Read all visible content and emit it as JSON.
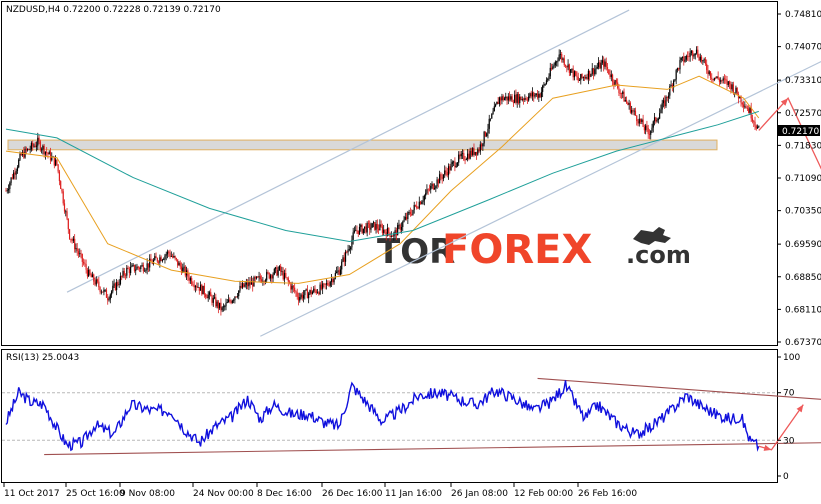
{
  "main_panel": {
    "header": "NZDUSD,H4  0.72200 0.72228 0.72139 0.72170",
    "last_price_label": "0.72170",
    "price_ticks": [
      "0.74810",
      "0.74070",
      "0.73310",
      "0.72570",
      "0.71830",
      "0.71090",
      "0.70350",
      "0.69590",
      "0.68850",
      "0.68110",
      "0.67370"
    ]
  },
  "rsi_panel": {
    "header": "RSI(13) 25.0043",
    "levels": [
      "100",
      "70",
      "30",
      "0"
    ]
  },
  "time_ticks": [
    "11 Oct 2017",
    "25 Oct 16:00",
    "9 Nov 08:00",
    "24 Nov 00:00",
    "8 Dec 16:00",
    "26 Dec 16:00",
    "11 Jan 16:00",
    "26 Jan 08:00",
    "12 Feb 00:00",
    "26 Feb 16:00"
  ],
  "watermark": {
    "part1": "TOR",
    "part2": "FOREX",
    "part3": ".com"
  },
  "colors": {
    "bull": "#000000",
    "bear": "#dd1f1f",
    "ma_fast": "#e8a020",
    "ma_slow": "#20a09a",
    "channel": "#b4c4d8",
    "support_zone": "#d9d9d9",
    "forecast": "#ee5a5a",
    "rsi": "#1010dd",
    "rsi_trend": "#a05050",
    "watermark_tor": "#333333",
    "watermark_forex": "#f0452a"
  },
  "chart_data": [
    {
      "type": "candlestick",
      "symbol": "NZDUSD",
      "timeframe": "H4",
      "ylim": [
        0.6737,
        0.7481
      ],
      "x_tick_labels": [
        "11 Oct 2017",
        "25 Oct 16:00",
        "9 Nov 08:00",
        "24 Nov 00:00",
        "8 Dec 16:00",
        "26 Dec 16:00",
        "11 Jan 16:00",
        "26 Jan 08:00",
        "12 Feb 00:00",
        "26 Feb 16:00"
      ],
      "close_path_anchors": [
        [
          0,
          0.708
        ],
        [
          12,
          0.716
        ],
        [
          25,
          0.719
        ],
        [
          40,
          0.714
        ],
        [
          50,
          0.698
        ],
        [
          65,
          0.689
        ],
        [
          80,
          0.684
        ],
        [
          95,
          0.69
        ],
        [
          110,
          0.691
        ],
        [
          128,
          0.694
        ],
        [
          145,
          0.688
        ],
        [
          160,
          0.684
        ],
        [
          170,
          0.681
        ],
        [
          185,
          0.686
        ],
        [
          200,
          0.688
        ],
        [
          215,
          0.69
        ],
        [
          230,
          0.684
        ],
        [
          250,
          0.686
        ],
        [
          262,
          0.69
        ],
        [
          275,
          0.699
        ],
        [
          290,
          0.7
        ],
        [
          305,
          0.698
        ],
        [
          318,
          0.703
        ],
        [
          335,
          0.709
        ],
        [
          355,
          0.715
        ],
        [
          372,
          0.7175
        ],
        [
          388,
          0.729
        ],
        [
          405,
          0.729
        ],
        [
          420,
          0.73
        ],
        [
          435,
          0.739
        ],
        [
          450,
          0.733
        ],
        [
          470,
          0.737
        ],
        [
          488,
          0.728
        ],
        [
          505,
          0.721
        ],
        [
          518,
          0.728
        ],
        [
          530,
          0.737
        ],
        [
          542,
          0.74
        ],
        [
          555,
          0.734
        ],
        [
          570,
          0.732
        ],
        [
          585,
          0.726
        ],
        [
          592,
          0.7217
        ]
      ],
      "moving_averages": [
        {
          "points": [
            [
              0,
              0.717
            ],
            [
              40,
              0.7155
            ],
            [
              80,
              0.696
            ],
            [
              130,
              0.69
            ],
            [
              180,
              0.6875
            ],
            [
              230,
              0.687
            ],
            [
              270,
              0.689
            ],
            [
              310,
              0.696
            ],
            [
              350,
              0.708
            ],
            [
              390,
              0.718
            ],
            [
              430,
              0.729
            ],
            [
              480,
              0.732
            ],
            [
              520,
              0.731
            ],
            [
              545,
              0.734
            ],
            [
              580,
              0.729
            ],
            [
              592,
              0.7245
            ]
          ]
        },
        {
          "points": [
            [
              0,
              0.722
            ],
            [
              40,
              0.72
            ],
            [
              100,
              0.711
            ],
            [
              160,
              0.704
            ],
            [
              220,
              0.699
            ],
            [
              270,
              0.6965
            ],
            [
              320,
              0.699
            ],
            [
              380,
              0.706
            ],
            [
              430,
              0.712
            ],
            [
              480,
              0.717
            ],
            [
              520,
              0.72
            ],
            [
              560,
              0.723
            ],
            [
              592,
              0.726
            ]
          ]
        }
      ],
      "support_zone": [
        0.7173,
        0.7195
      ],
      "channel_lines": [
        [
          [
            48,
            0.685
          ],
          [
            490,
            0.749
          ]
        ],
        [
          [
            200,
            0.675
          ],
          [
            660,
            0.74
          ]
        ]
      ],
      "forecast_path": [
        [
          592,
          0.7217
        ],
        [
          615,
          0.729
        ],
        [
          655,
          0.7045
        ]
      ]
    },
    {
      "type": "line",
      "name": "RSI(13)",
      "last_value": 25.0043,
      "ylim": [
        0,
        100
      ],
      "levels": [
        70,
        30
      ],
      "path_anchors": [
        [
          0,
          45
        ],
        [
          10,
          70
        ],
        [
          20,
          62
        ],
        [
          30,
          60
        ],
        [
          40,
          40
        ],
        [
          48,
          26
        ],
        [
          60,
          28
        ],
        [
          70,
          43
        ],
        [
          85,
          35
        ],
        [
          98,
          60
        ],
        [
          115,
          55
        ],
        [
          130,
          55
        ],
        [
          140,
          40
        ],
        [
          152,
          28
        ],
        [
          165,
          42
        ],
        [
          178,
          50
        ],
        [
          190,
          65
        ],
        [
          200,
          48
        ],
        [
          210,
          60
        ],
        [
          225,
          52
        ],
        [
          238,
          52
        ],
        [
          250,
          45
        ],
        [
          262,
          42
        ],
        [
          272,
          76
        ],
        [
          285,
          60
        ],
        [
          296,
          46
        ],
        [
          310,
          55
        ],
        [
          325,
          68
        ],
        [
          340,
          70
        ],
        [
          355,
          65
        ],
        [
          370,
          60
        ],
        [
          385,
          72
        ],
        [
          400,
          65
        ],
        [
          415,
          55
        ],
        [
          428,
          62
        ],
        [
          440,
          76
        ],
        [
          455,
          48
        ],
        [
          465,
          60
        ],
        [
          480,
          45
        ],
        [
          495,
          35
        ],
        [
          505,
          40
        ],
        [
          520,
          52
        ],
        [
          535,
          68
        ],
        [
          545,
          60
        ],
        [
          558,
          52
        ],
        [
          570,
          48
        ],
        [
          578,
          50
        ],
        [
          585,
          30
        ],
        [
          592,
          25
        ]
      ],
      "trend_lines": [
        [
          [
            30,
            18
          ],
          [
            645,
            28
          ]
        ],
        [
          [
            418,
            82
          ],
          [
            685,
            61
          ]
        ]
      ],
      "forecast_path": [
        [
          592,
          25
        ],
        [
          602,
          22
        ],
        [
          627,
          60
        ]
      ]
    }
  ]
}
